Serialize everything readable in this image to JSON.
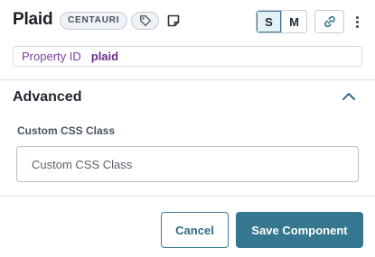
{
  "header": {
    "title": "Plaid",
    "badge": "CENTAURI",
    "size_options": [
      "S",
      "M"
    ],
    "selected_size": "S"
  },
  "property": {
    "label": "Property ID",
    "value": "plaid"
  },
  "section": {
    "title": "Advanced",
    "expanded": true
  },
  "field": {
    "label": "Custom CSS Class",
    "placeholder": "Custom CSS Class",
    "value": ""
  },
  "footer": {
    "cancel_label": "Cancel",
    "save_label": "Save Component"
  },
  "colors": {
    "accent": "#35778f",
    "property_text": "#6a2d8f"
  },
  "icons": [
    "tag-icon",
    "note-icon",
    "link-icon",
    "more-vertical-icon",
    "chevron-up-icon"
  ]
}
